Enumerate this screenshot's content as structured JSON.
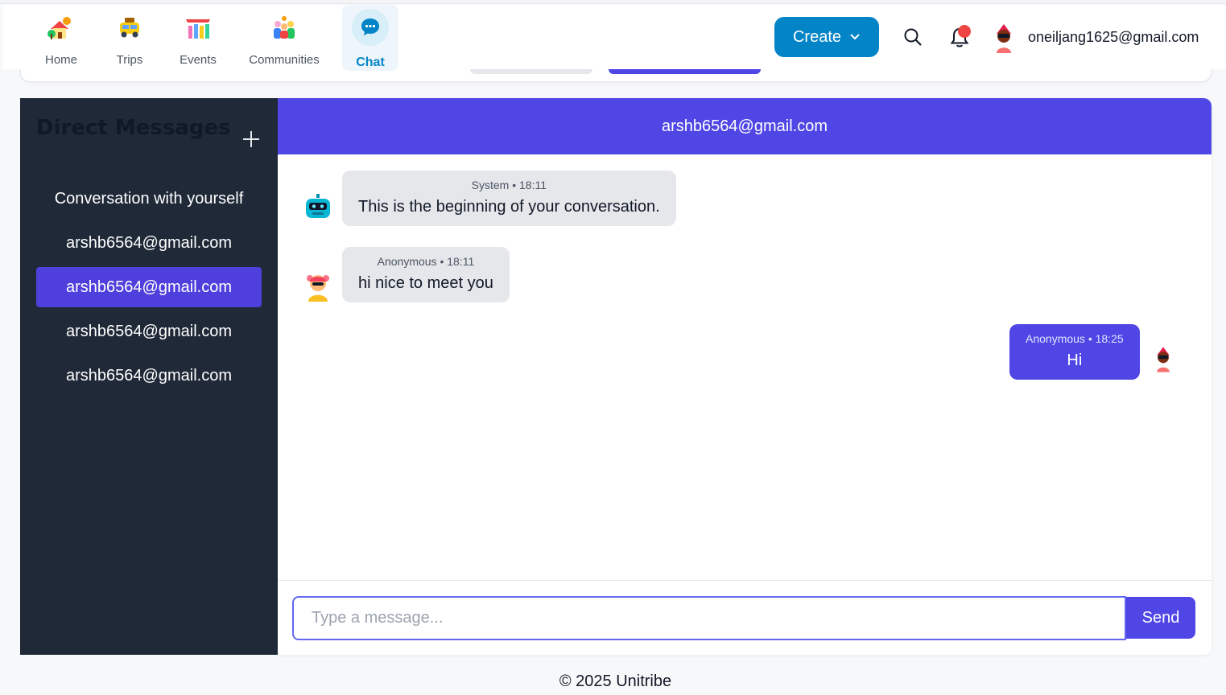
{
  "nav": {
    "items": [
      {
        "label": "Home",
        "icon": "home-icon"
      },
      {
        "label": "Trips",
        "icon": "trips-icon"
      },
      {
        "label": "Events",
        "icon": "events-icon"
      },
      {
        "label": "Communities",
        "icon": "communities-icon"
      },
      {
        "label": "Chat",
        "icon": "chat-icon",
        "active": true
      }
    ],
    "create_label": "Create",
    "user_email": "oneiljang1625@gmail.com"
  },
  "sidebar": {
    "title": "Direct Messages",
    "conversations": [
      {
        "label": "Conversation with yourself"
      },
      {
        "label": "arshb6564@gmail.com"
      },
      {
        "label": "arshb6564@gmail.com",
        "active": true
      },
      {
        "label": "arshb6564@gmail.com"
      },
      {
        "label": "arshb6564@gmail.com"
      }
    ]
  },
  "chat": {
    "header": "arshb6564@gmail.com",
    "messages": [
      {
        "meta": "System • 18:11",
        "text": "This is the beginning of your conversation.",
        "direction": "in",
        "avatar": "robot-avatar-icon"
      },
      {
        "meta": "Anonymous • 18:11",
        "text": "hi nice to meet you",
        "direction": "in",
        "avatar": "girl-avatar-icon"
      },
      {
        "meta": "Anonymous • 18:25",
        "text": "Hi",
        "direction": "out",
        "avatar": "user-avatar-icon"
      }
    ],
    "input_placeholder": "Type a message...",
    "send_label": "Send"
  },
  "footer": {
    "text": "© 2025 Unitribe"
  },
  "colors": {
    "primary": "#4f46e5",
    "nav_accent": "#0284c7",
    "sidebar_bg": "#1f2937",
    "notification": "#ef4444"
  }
}
